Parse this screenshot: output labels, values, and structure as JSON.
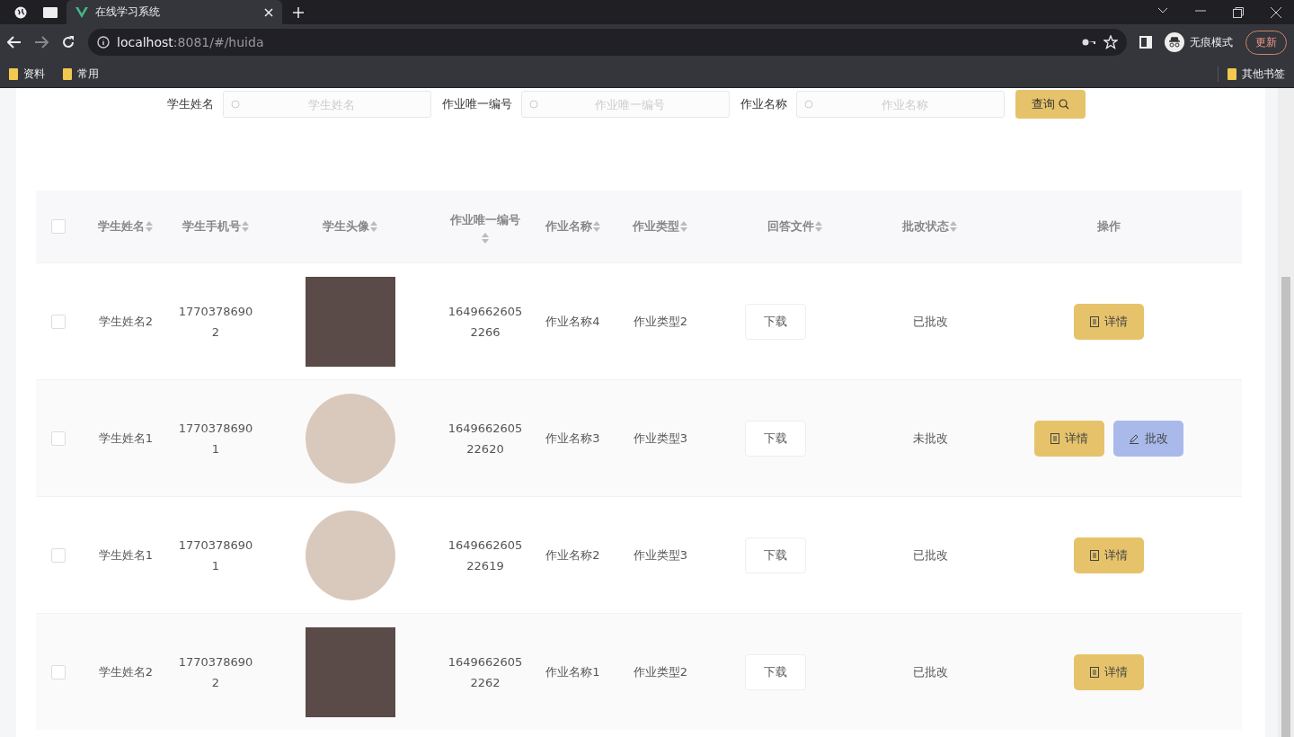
{
  "browser": {
    "tab_title": "在线学习系统",
    "url_host": "localhost",
    "url_path": ":8081/#/huida",
    "profile_label": "无痕模式",
    "update_button": "更新",
    "bookmarks": [
      "资料",
      "常用"
    ],
    "other_bookmarks": "其他书签"
  },
  "search": {
    "fields": [
      {
        "label": "学生姓名",
        "placeholder": "学生姓名"
      },
      {
        "label": "作业唯一编号",
        "placeholder": "作业唯一编号"
      },
      {
        "label": "作业名称",
        "placeholder": "作业名称"
      }
    ],
    "button": "查询"
  },
  "table": {
    "all_checked": false,
    "columns": [
      {
        "label": "学生姓名",
        "sortable": true
      },
      {
        "label": "学生手机号",
        "sortable": true
      },
      {
        "label": "学生头像",
        "sortable": true
      },
      {
        "label": "作业唯一编号",
        "sortable": true
      },
      {
        "label": "作业名称",
        "sortable": true
      },
      {
        "label": "作业类型",
        "sortable": true
      },
      {
        "label": "回答文件",
        "sortable": true
      },
      {
        "label": "批改状态",
        "sortable": true
      },
      {
        "label": "操作",
        "sortable": false
      }
    ],
    "rows": [
      {
        "checked": false,
        "name": "学生姓名2",
        "phone": "17703786902",
        "avatar": {
          "kind": "square"
        },
        "homework_id": "16496626052266",
        "homework_name": "作业名称4",
        "homework_type": "作业类型2",
        "file_button": "下载",
        "status": "已批改",
        "actions": [
          {
            "kind": "detail",
            "label": "详情"
          }
        ]
      },
      {
        "checked": false,
        "name": "学生姓名1",
        "phone": "17703786901",
        "avatar": {
          "kind": "round"
        },
        "homework_id": "164966260522620",
        "homework_name": "作业名称3",
        "homework_type": "作业类型3",
        "file_button": "下载",
        "status": "未批改",
        "actions": [
          {
            "kind": "detail",
            "label": "详情"
          },
          {
            "kind": "review",
            "label": "批改"
          }
        ]
      },
      {
        "checked": false,
        "name": "学生姓名1",
        "phone": "17703786901",
        "avatar": {
          "kind": "round"
        },
        "homework_id": "164966260522619",
        "homework_name": "作业名称2",
        "homework_type": "作业类型3",
        "file_button": "下载",
        "status": "已批改",
        "actions": [
          {
            "kind": "detail",
            "label": "详情"
          }
        ]
      },
      {
        "checked": false,
        "name": "学生姓名2",
        "phone": "17703786902",
        "avatar": {
          "kind": "square"
        },
        "homework_id": "16496626052262",
        "homework_name": "作业名称1",
        "homework_type": "作业类型2",
        "file_button": "下载",
        "status": "已批改",
        "actions": [
          {
            "kind": "detail",
            "label": "详情"
          }
        ]
      }
    ]
  }
}
